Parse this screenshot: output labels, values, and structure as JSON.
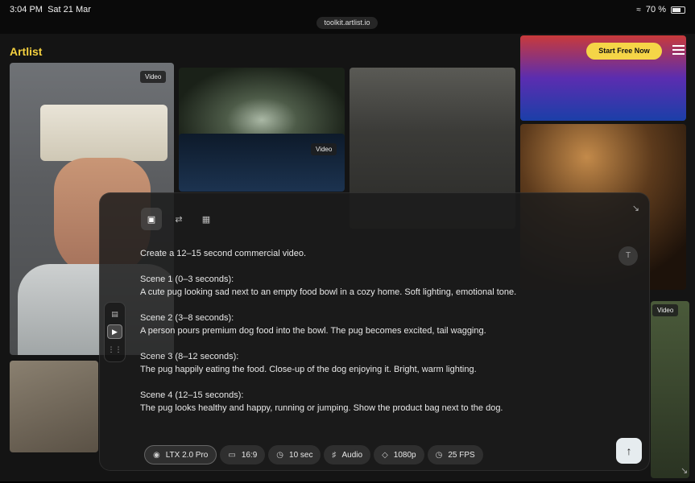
{
  "status_bar": {
    "time": "3:04 PM",
    "date": "Sat 21 Mar",
    "battery": "70 %",
    "url": "toolkit.artlist.io"
  },
  "header": {
    "logo": "Artlist",
    "cta_label": "Start Free Now"
  },
  "tiles": {
    "badge_label": "Video"
  },
  "composer": {
    "mode_icons": [
      "image-plus-icon",
      "swap-icon",
      "image-icon"
    ],
    "prompt_lines": [
      "Create a 12–15 second commercial video.",
      "Scene 1 (0–3 seconds):",
      "A cute pug looking sad next to an empty food bowl in a cozy home. Soft lighting, emotional tone.",
      "Scene 2 (3–8 seconds):",
      "A person pours premium dog food into the bowl. The pug becomes excited, tail wagging.",
      "Scene 3 (8–12 seconds):",
      "The pug happily eating the food. Close-up of the dog enjoying it. Bright, warm lighting.",
      "Scene 4 (12–15 seconds):",
      "The pug looks healthy and happy, running or jumping. Show the product bag next to the dog."
    ],
    "options": {
      "model": "LTX 2.0 Pro",
      "aspect": "16:9",
      "duration": "10 sec",
      "audio": "Audio",
      "resolution": "1080p",
      "fps": "25 FPS"
    },
    "side_tools": [
      "image-icon",
      "video-icon",
      "audio-wave-icon"
    ]
  },
  "colors": {
    "brand_yellow": "#f5d547",
    "panel_bg": "#1c1c1c"
  }
}
